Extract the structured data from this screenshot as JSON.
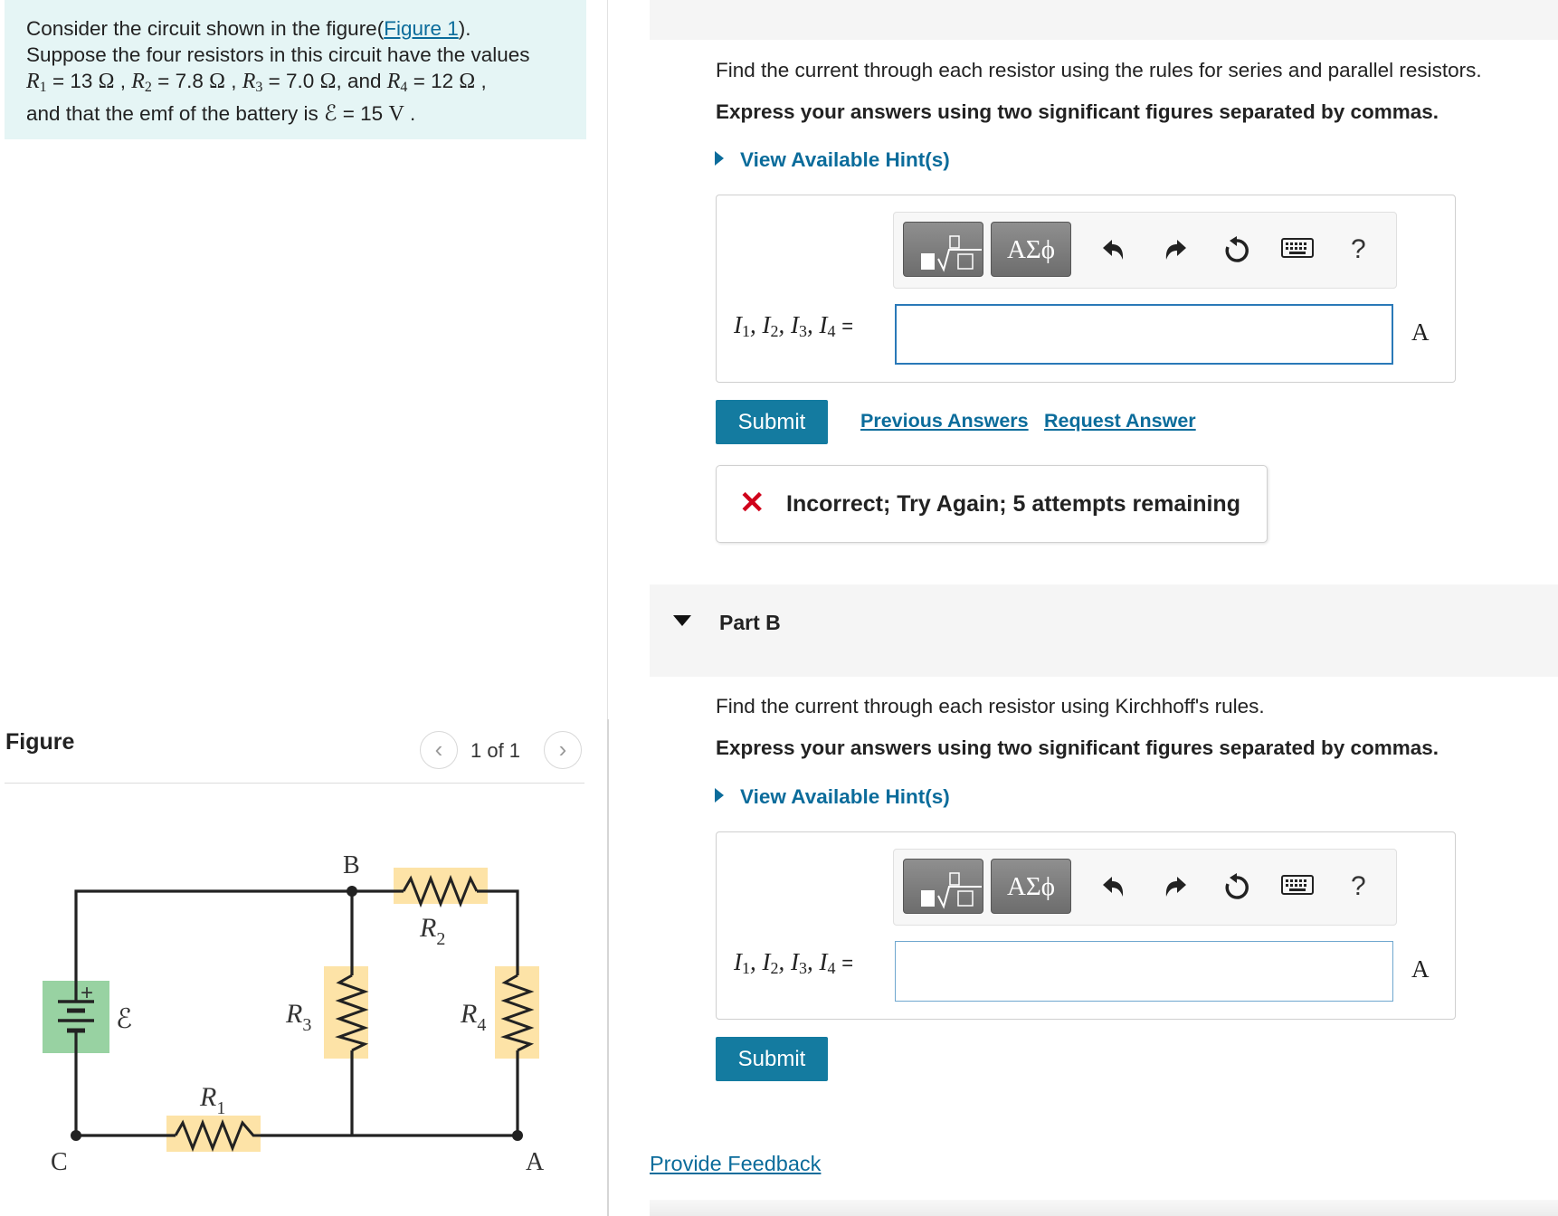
{
  "problem": {
    "text_1": "Consider the circuit shown in the figure(",
    "figure_link": "Figure 1",
    "text_2": ").",
    "line_2": "Suppose the four resistors in this circuit have the values",
    "r1_sym": "R",
    "r1_sub": "1",
    "r1_val": "= 13",
    "r2_sym": "R",
    "r2_sub": "2",
    "r2_val": "= 7.8",
    "r3_sym": "R",
    "r3_sub": "3",
    "r3_val": "= 7.0",
    "and": ", and",
    "r4_sym": "R",
    "r4_sub": "4",
    "r4_val": "= 12",
    "ohm": "Ω",
    "line_4_a": "and that the emf of the battery is",
    "emf_sym": "ℰ",
    "emf_val": "= 15",
    "volt": "V"
  },
  "figure": {
    "heading": "Figure",
    "pager_prev": "‹",
    "pager_count": "1 of 1",
    "pager_next": "›",
    "labels": {
      "b": "B",
      "a": "A",
      "c": "C",
      "emf": "ℰ",
      "r1": "R",
      "r1_sub": "1",
      "r2": "R",
      "r2_sub": "2",
      "r3": "R",
      "r3_sub": "3",
      "r4": "R",
      "r4_sub": "4",
      "plus": "+"
    },
    "colors": {
      "resistor_highlight": "#fde3a7",
      "battery_highlight": "#98d2a2",
      "wire": "#222222"
    }
  },
  "part_a": {
    "prompt": "Find the current through each resistor using the rules for series and parallel resistors.",
    "instruction": "Express your answers using two significant figures separated by commas.",
    "hint": "View Available Hint(s)",
    "toolbar": {
      "greek": "ΑΣϕ",
      "undo_icon": "undo-icon",
      "redo_icon": "redo-icon",
      "reset_icon": "reset-icon",
      "keyboard_icon": "keyboard-icon",
      "help": "?"
    },
    "eq_label": {
      "i": "I",
      "s1": "1",
      "s2": "2",
      "s3": "3",
      "s4": "4",
      "sep": ",",
      "eq": "="
    },
    "input_value": "",
    "unit": "A",
    "submit": "Submit",
    "previous_answers": "Previous Answers",
    "request_answer": "Request Answer",
    "feedback": "Incorrect; Try Again; 5 attempts remaining"
  },
  "part_b": {
    "title": "Part B",
    "prompt": "Find the current through each resistor using Kirchhoff's rules.",
    "instruction": "Express your answers using two significant figures separated by commas.",
    "hint": "View Available Hint(s)",
    "toolbar": {
      "greek": "ΑΣϕ",
      "help": "?"
    },
    "input_value": "",
    "unit": "A",
    "submit": "Submit"
  },
  "footer": {
    "provide_feedback": "Provide Feedback"
  },
  "colors": {
    "link": "#0b6c9b",
    "submit_bg": "#147ba0",
    "error": "#d0021b",
    "problem_bg": "#e5f5f5"
  }
}
